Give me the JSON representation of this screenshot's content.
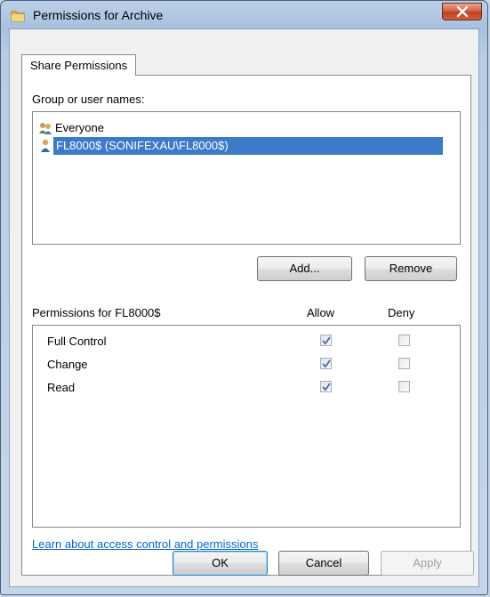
{
  "window": {
    "title": "Permissions for Archive"
  },
  "tabs": [
    {
      "label": "Share Permissions"
    }
  ],
  "group": {
    "label": "Group or user names:",
    "users": [
      {
        "name": "Everyone",
        "icon": "group-users-icon",
        "selected": false
      },
      {
        "name": "FL8000$ (SONIFEXAU\\FL8000$)",
        "icon": "user-icon",
        "selected": true
      }
    ],
    "add_label": "Add...",
    "remove_label": "Remove"
  },
  "permissions": {
    "label": "Permissions for FL8000$",
    "allow_header": "Allow",
    "deny_header": "Deny",
    "rows": [
      {
        "name": "Full Control",
        "allow": true,
        "deny": false
      },
      {
        "name": "Change",
        "allow": true,
        "deny": false
      },
      {
        "name": "Read",
        "allow": true,
        "deny": false
      }
    ]
  },
  "link_text": "Learn about access control and permissions",
  "footer": {
    "ok": "OK",
    "cancel": "Cancel",
    "apply": "Apply"
  },
  "colors": {
    "selection": "#3d7ac9",
    "link": "#0066cc",
    "close": "#c0401f"
  }
}
